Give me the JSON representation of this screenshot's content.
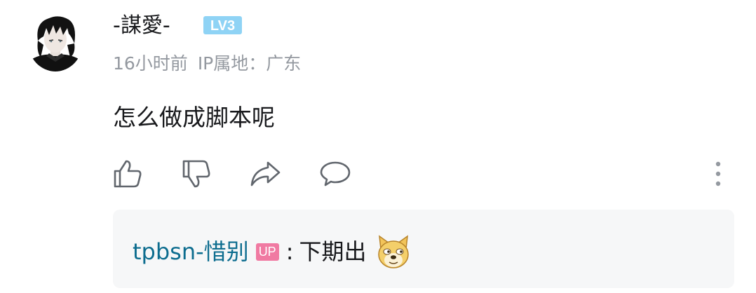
{
  "comment": {
    "username": "-謀愛-",
    "level_badge": "LV3",
    "time": "16小时前",
    "ip_location": "IP属地：广东",
    "content": "怎么做成脚本呢"
  },
  "actions": [
    {
      "name": "like",
      "icon": "thumb-up-icon"
    },
    {
      "name": "dislike",
      "icon": "thumb-down-icon"
    },
    {
      "name": "share",
      "icon": "share-arrow-icon"
    },
    {
      "name": "reply",
      "icon": "comment-bubble-icon"
    },
    {
      "name": "more",
      "icon": "vertical-dots-icon"
    }
  ],
  "reply": {
    "username": "tpbsn-惜别",
    "badge": "UP",
    "separator": ":",
    "text": "下期出",
    "emoji": "doge-emoji"
  },
  "colors": {
    "username": "#18191c",
    "meta": "#9499a0",
    "reply_username": "#0d6d8f",
    "up_badge": "#f07aa2",
    "level_badge": "#8fd3f5",
    "reply_bg": "#f6f7f8"
  }
}
